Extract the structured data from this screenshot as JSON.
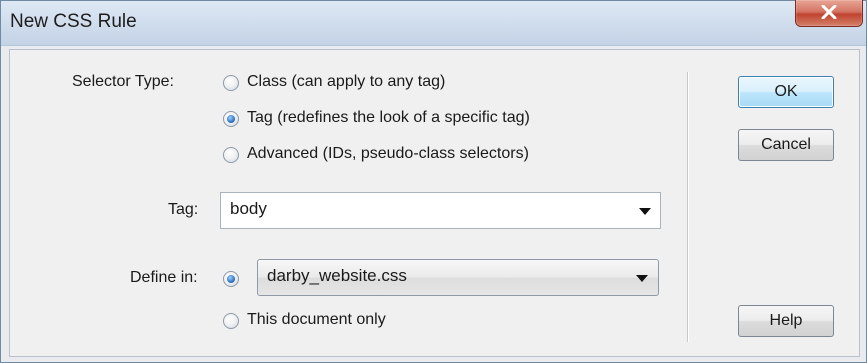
{
  "window": {
    "title": "New CSS Rule"
  },
  "selector_type": {
    "label": "Selector Type:",
    "options": [
      {
        "label": "Class (can apply to any tag)",
        "checked": false
      },
      {
        "label": "Tag (redefines the look of a specific tag)",
        "checked": true
      },
      {
        "label": "Advanced (IDs, pseudo-class selectors)",
        "checked": false
      }
    ]
  },
  "tag": {
    "label": "Tag:",
    "value": "body"
  },
  "define_in": {
    "label": "Define in:",
    "file_value": "darby_website.css",
    "file_checked": true,
    "doc_only_label": "This document only",
    "doc_only_checked": false
  },
  "buttons": {
    "ok": "OK",
    "cancel": "Cancel",
    "help": "Help"
  },
  "colors": {
    "default_button_border": "#3c7fb1",
    "radio_checked": "#2d75c7",
    "close_button": "#c0432f"
  }
}
